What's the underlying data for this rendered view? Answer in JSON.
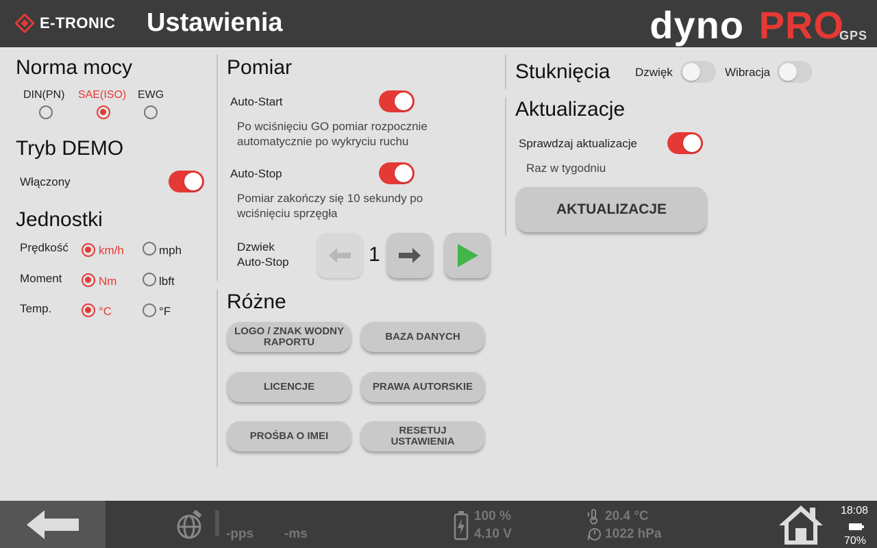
{
  "header": {
    "brand": "E-TRONIC",
    "title": "Ustawienia",
    "product_main": "dyno",
    "product_accent": "PRO",
    "product_sub": "GPS"
  },
  "norma": {
    "title": "Norma mocy",
    "options": [
      {
        "label": "DIN(PN)",
        "selected": false
      },
      {
        "label": "SAE(ISO)",
        "selected": true
      },
      {
        "label": "EWG",
        "selected": false
      }
    ]
  },
  "demo": {
    "title": "Tryb DEMO",
    "label": "Włączony",
    "on": true
  },
  "units": {
    "title": "Jednostki",
    "rows": [
      {
        "label": "Prędkość",
        "opt1": "km/h",
        "opt2": "mph"
      },
      {
        "label": "Moment",
        "opt1": "Nm",
        "opt2": "lbft"
      },
      {
        "label": "Temp.",
        "opt1": "°C",
        "opt2": "°F"
      }
    ]
  },
  "pomiar": {
    "title": "Pomiar",
    "autostart_label": "Auto-Start",
    "autostart_desc_1": "Po wciśnięciu GO pomiar rozpocznie",
    "autostart_desc_2": "automatycznie po wykryciu ruchu",
    "autostop_label": "Auto-Stop",
    "autostop_desc_1": "Pomiar zakończy się 10 sekundy po",
    "autostop_desc_2": "wciśnięciu sprzęgła",
    "sound_label_1": "Dzwiek",
    "sound_label_2": "Auto-Stop",
    "sound_value": "1"
  },
  "rozne": {
    "title": "Różne",
    "btn_logo_1": "LOGO / ZNAK WODNY",
    "btn_logo_2": "RAPORTU",
    "btn_baza": "BAZA DANYCH",
    "btn_licencje": "LICENCJE",
    "btn_prawa": "PRAWA AUTORSKIE",
    "btn_imei": "PROŚBA O IMEI",
    "btn_reset_1": "RESETUJ",
    "btn_reset_2": "USTAWIENIA"
  },
  "stukniecia": {
    "title": "Stuknięcia",
    "sound_label": "Dzwięk",
    "vibration_label": "Wibracja"
  },
  "aktualizacje": {
    "title": "Aktualizacje",
    "check_label": "Sprawdzaj aktualizacje",
    "frequency": "Raz w tygodniu",
    "button": "AKTUALIZACJE"
  },
  "footer": {
    "pps": "-pps",
    "ms": "-ms",
    "battery_pct": "100 %",
    "voltage": "4.10 V",
    "temperature": "20.4 °C",
    "pressure": "1022 hPa",
    "time": "18:08",
    "device_battery": "70%"
  },
  "colors": {
    "accent": "#e53935",
    "header_bg": "#3c3c3c",
    "panel_bg": "#e2e2e2",
    "button_bg": "#c9c9c9",
    "play_green": "#43b649"
  }
}
